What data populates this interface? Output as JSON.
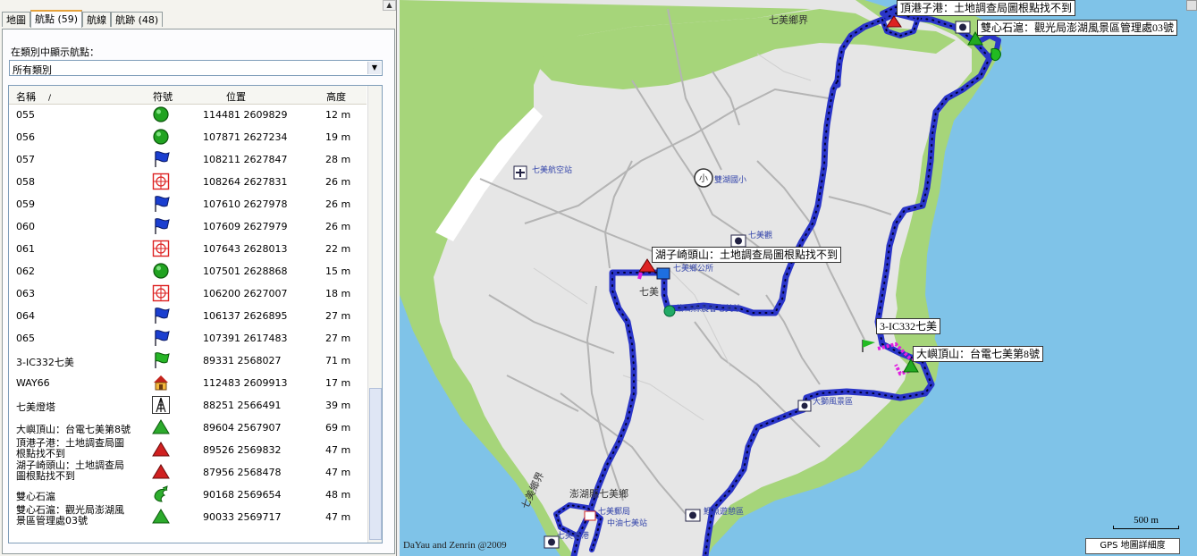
{
  "tabs": [
    {
      "label": "地圖",
      "active": false
    },
    {
      "label": "航點 (59)",
      "active": true
    },
    {
      "label": "航線",
      "active": false
    },
    {
      "label": "航跡 (48)",
      "active": false
    }
  ],
  "filter": {
    "label": "在類別中顯示航點：",
    "value": "所有類別"
  },
  "columns": {
    "name": "名稱",
    "symbol": "符號",
    "position": "位置",
    "altitude": "高度"
  },
  "waypoints": [
    {
      "name": "055",
      "icon": "green-circle-icon",
      "position": "114481 2609829",
      "altitude": "12 m"
    },
    {
      "name": "056",
      "icon": "green-circle-icon",
      "position": "107871 2627234",
      "altitude": "19 m"
    },
    {
      "name": "057",
      "icon": "blue-flag-icon",
      "position": "108211 2627847",
      "altitude": "28 m"
    },
    {
      "name": "058",
      "icon": "red-crosshair-icon",
      "position": "108264 2627831",
      "altitude": "26 m"
    },
    {
      "name": "059",
      "icon": "blue-flag-icon",
      "position": "107610 2627978",
      "altitude": "26 m"
    },
    {
      "name": "060",
      "icon": "blue-flag-icon",
      "position": "107609 2627979",
      "altitude": "26 m"
    },
    {
      "name": "061",
      "icon": "red-crosshair-icon",
      "position": "107643 2628013",
      "altitude": "22 m"
    },
    {
      "name": "062",
      "icon": "green-circle-icon",
      "position": "107501 2628868",
      "altitude": "15 m"
    },
    {
      "name": "063",
      "icon": "red-crosshair-icon",
      "position": "106200 2627007",
      "altitude": "18 m"
    },
    {
      "name": "064",
      "icon": "blue-flag-icon",
      "position": "106137 2626895",
      "altitude": "27 m"
    },
    {
      "name": "065",
      "icon": "blue-flag-icon",
      "position": "107391 2617483",
      "altitude": "27 m"
    },
    {
      "name": "3-IC332七美",
      "icon": "green-flag-icon",
      "position": "89331 2568027",
      "altitude": "71 m"
    },
    {
      "name": "WAY66",
      "icon": "house-icon",
      "position": "112483 2609913",
      "altitude": "17 m"
    },
    {
      "name": "七美燈塔",
      "icon": "tower-icon",
      "position": "88251 2566491",
      "altitude": "39 m"
    },
    {
      "name": "大嶼頂山：台電七美第8號",
      "icon": "green-triangle-icon",
      "position": "89604 2567907",
      "altitude": "69 m"
    },
    {
      "name": "頂港子港：土地調查局圖根點找不到",
      "line1": "頂港子港：土地調查局圖",
      "line2": "根點找不到",
      "icon": "red-triangle-icon",
      "position": "89526 2569832",
      "altitude": "47 m"
    },
    {
      "name": "湖子崎頭山：土地調查局圖根點找不到",
      "line1": "湖子崎頭山：土地調查局",
      "line2": "圖根點找不到",
      "icon": "red-triangle-icon",
      "position": "87956 2568478",
      "altitude": "47 m"
    },
    {
      "name": "雙心石滬",
      "icon": "green-fish-icon",
      "position": "90168 2569654",
      "altitude": "48 m"
    },
    {
      "name": "雙心石滬：觀光局澎湖風景區管理處03號",
      "line1": "雙心石滬：觀光局澎湖風",
      "line2": "景區管理處03號",
      "icon": "green-triangle-icon",
      "position": "90033 2569717",
      "altitude": "47 m"
    }
  ],
  "map": {
    "labels": {
      "dinggang": "頂港子港：土地調查局圖根點找不到",
      "shuangxin": "雙心石滬：觀光局澎湖風景區管理處03號",
      "huziqi": "湖子崎頭山：土地調查局圖根點找不到",
      "ic332": "3-IC332七美",
      "dayu": "大嶼頂山：台電七美第8號"
    },
    "place_names": {
      "township_top": "七美鄉界",
      "airport": "七美航空站",
      "school": "雙湖國小",
      "qimei_center": "七美",
      "township_office": "七美鄉公所",
      "farmers": "澎湖縣農會七美站",
      "qimei_view": "七美觀",
      "dashi": "大獅風景區",
      "penghu_qimei": "澎湖縣七美鄉",
      "township_left": "七美鄉界",
      "post": "七美郵局",
      "cpc": "中油七美站",
      "harbor": "七美漁港",
      "leisure": "鯉魚遊憩區"
    },
    "scale": "500 m",
    "detail": "GPS 地圖詳細度",
    "copyright": "DaYau and  Zenrin @2009"
  }
}
